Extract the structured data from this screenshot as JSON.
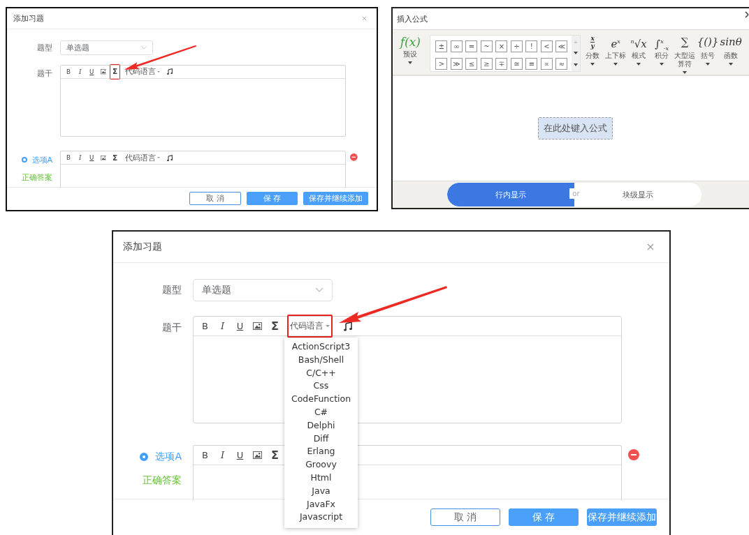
{
  "screenshots": [
    {
      "kind": "exercise_dialog",
      "title": "添加习题",
      "type_label": "题型",
      "type_value": "单选题",
      "stem_label": "题干",
      "stem_toolbar": [
        {
          "kind": "bold",
          "label": "B",
          "highlighted": false
        },
        {
          "kind": "italic",
          "label": "I",
          "highlighted": false
        },
        {
          "kind": "underline",
          "label": "U",
          "highlighted": false
        },
        {
          "kind": "image",
          "highlighted": false
        },
        {
          "kind": "formula",
          "label": "Σ",
          "highlighted": true
        },
        {
          "kind": "code",
          "label": "代码语言",
          "highlighted": false
        },
        {
          "kind": "music",
          "highlighted": false
        }
      ],
      "option": {
        "label": "选项A",
        "selected": true,
        "correct_label": "正确答案",
        "toolbar": [
          {
            "kind": "bold",
            "label": "B"
          },
          {
            "kind": "italic",
            "label": "I"
          },
          {
            "kind": "underline",
            "label": "U"
          },
          {
            "kind": "image"
          },
          {
            "kind": "formula",
            "label": "Σ"
          },
          {
            "kind": "code",
            "label": "代码语言"
          },
          {
            "kind": "music"
          }
        ]
      },
      "buttons": [
        {
          "label": "取 消",
          "kind": "secondary"
        },
        {
          "label": "保 存",
          "kind": "primary"
        },
        {
          "label": "保存并继续添加",
          "kind": "primary"
        }
      ]
    },
    {
      "kind": "formula_dialog",
      "title": "插入公式",
      "preset": {
        "symbol": "f(x)",
        "label": "预设"
      },
      "symbols": [
        "±",
        "∞",
        "=",
        "~",
        "×",
        "÷",
        "!",
        "<",
        "≪",
        ">",
        "≫",
        "≤",
        "≥",
        "∓",
        "≅",
        "≡",
        "∝",
        "≈"
      ],
      "categories": [
        {
          "kind": "fraction",
          "top": "x",
          "bottom": "y",
          "label": "分数"
        },
        {
          "kind": "plain",
          "symbol": "e$^{x}$",
          "label": "上下标"
        },
        {
          "kind": "plain",
          "symbol": "$^{n}$√x",
          "label": "根式"
        },
        {
          "kind": "plain",
          "symbol": "∫$^{x}$$_{-x}$",
          "label": "积分"
        },
        {
          "kind": "plain",
          "symbol": "∑",
          "label": "大型运算符"
        },
        {
          "kind": "plain",
          "symbol": "{()}",
          "label": "括号"
        },
        {
          "kind": "plain",
          "symbol": "sinθ",
          "label": "函数"
        }
      ],
      "placeholder": "在此处键入公式",
      "display_modes": [
        {
          "label": "行内显示",
          "selected": true
        },
        {
          "label": "块级显示",
          "selected": false
        }
      ],
      "or_label": "or"
    },
    {
      "kind": "exercise_dialog",
      "title": "添加习题",
      "type_label": "题型",
      "type_value": "单选题",
      "stem_label": "题干",
      "stem_toolbar": [
        {
          "kind": "bold",
          "label": "B",
          "highlighted": false
        },
        {
          "kind": "italic",
          "label": "I",
          "highlighted": false
        },
        {
          "kind": "underline",
          "label": "U",
          "highlighted": false
        },
        {
          "kind": "image",
          "highlighted": false
        },
        {
          "kind": "formula",
          "label": "Σ",
          "highlighted": false
        },
        {
          "kind": "code",
          "label": "代码语言",
          "highlighted": true,
          "options": [
            "ActionScript3",
            "Bash/Shell",
            "C/C++",
            "Css",
            "CodeFunction",
            "C#",
            "Delphi",
            "Diff",
            "Erlang",
            "Groovy",
            "Html",
            "Java",
            "JavaFx",
            "Javascript"
          ]
        },
        {
          "kind": "music",
          "highlighted": false
        }
      ],
      "option": {
        "label": "选项A",
        "selected": true,
        "correct_label": "正确答案",
        "toolbar": [
          {
            "kind": "bold",
            "label": "B"
          },
          {
            "kind": "italic",
            "label": "I"
          },
          {
            "kind": "underline",
            "label": "U"
          },
          {
            "kind": "image"
          },
          {
            "kind": "formula",
            "label": "Σ"
          }
        ]
      },
      "buttons": [
        {
          "label": "取 消",
          "kind": "secondary"
        },
        {
          "label": "保 存",
          "kind": "primary"
        },
        {
          "label": "保存并继续添加",
          "kind": "primary"
        }
      ]
    }
  ]
}
